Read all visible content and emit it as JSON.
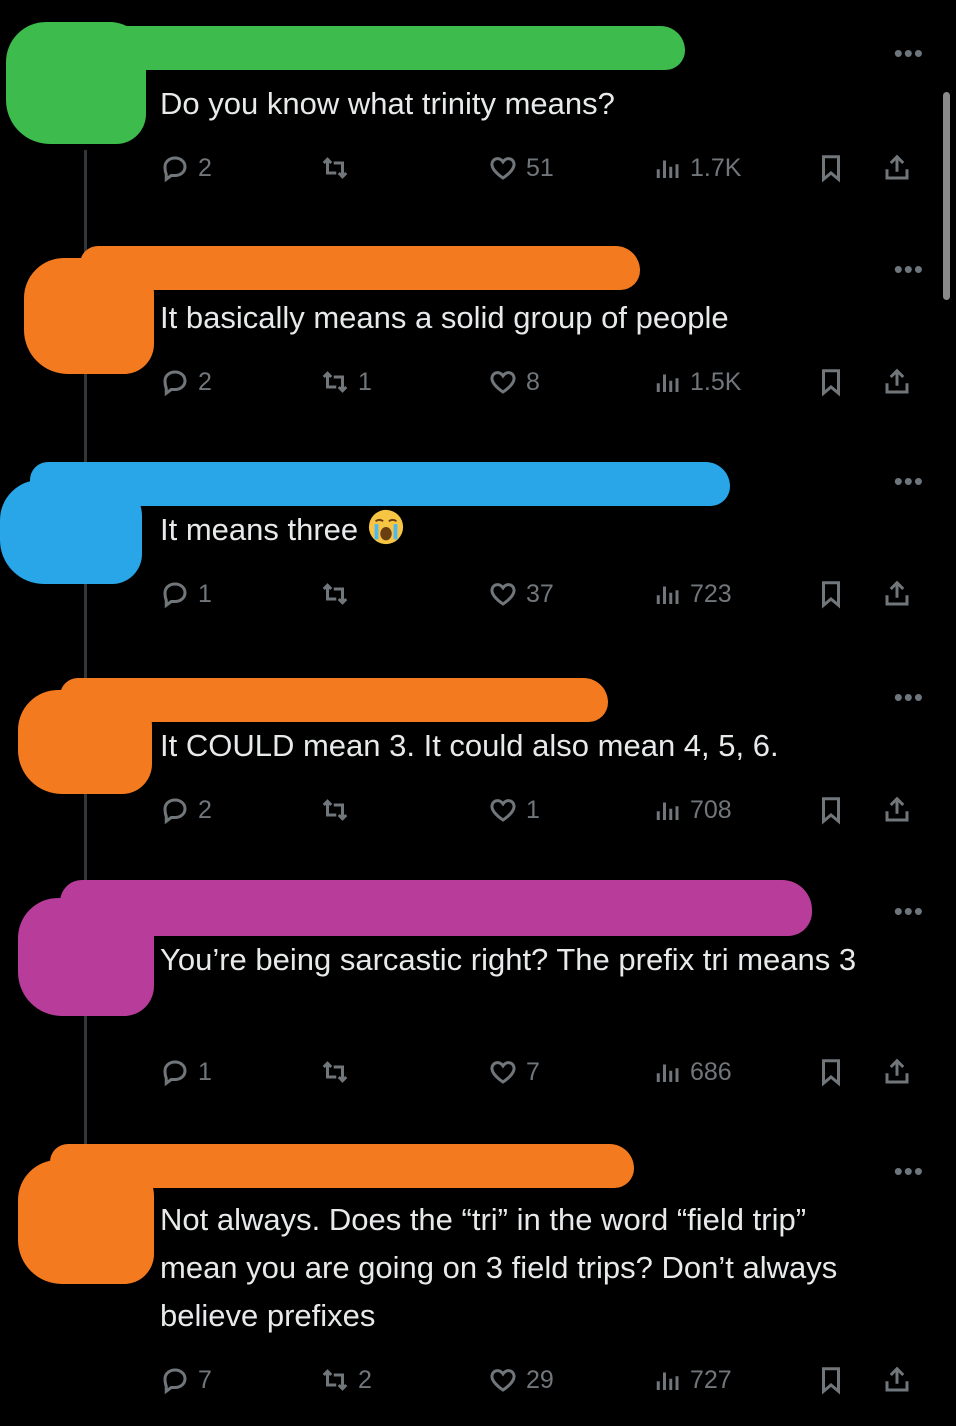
{
  "thread": {
    "posts": [
      {
        "text": "Do you know what trinity means?",
        "replies": "2",
        "reposts": "",
        "likes": "51",
        "views": "1.7K",
        "redaction_color": "#3dbb4c"
      },
      {
        "text": "It basically means a solid group of people",
        "replies": "2",
        "reposts": "1",
        "likes": "8",
        "views": "1.5K",
        "redaction_color": "#f47a1f"
      },
      {
        "text": "It means three",
        "emoji": "loudly-crying-face",
        "replies": "1",
        "reposts": "",
        "likes": "37",
        "views": "723",
        "redaction_color": "#28a6e8"
      },
      {
        "text": "It COULD mean 3. It could also mean 4, 5, 6.",
        "replies": "2",
        "reposts": "",
        "likes": "1",
        "views": "708",
        "redaction_color": "#f47a1f"
      },
      {
        "text": "You’re being sarcastic right? The prefix tri means 3",
        "replies": "1",
        "reposts": "",
        "likes": "7",
        "views": "686",
        "redaction_color": "#b83c9a"
      },
      {
        "text": "Not always. Does the “tri” in the word “field trip” mean you are going on 3 field trips? Don’t always believe prefixes",
        "replies": "7",
        "reposts": "2",
        "likes": "29",
        "views": "727",
        "redaction_color": "#f47a1f"
      }
    ],
    "more_label": "•••",
    "icons": [
      "reply-icon",
      "repost-icon",
      "like-icon",
      "views-icon",
      "bookmark-icon",
      "share-icon"
    ]
  }
}
